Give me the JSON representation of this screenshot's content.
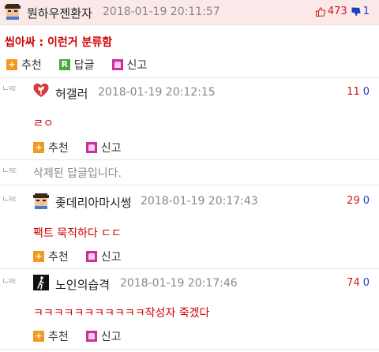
{
  "post": {
    "author": "뭔하우젠환자",
    "timestamp": "2018-01-19 20:11:57",
    "upvotes": "473",
    "downvotes": "1",
    "content": "씹아싸 : 이런거 분류함",
    "actions": {
      "recommend": "추천",
      "reply": "답글",
      "report": "신고"
    },
    "reply_badge": "R"
  },
  "re_label": "RE",
  "comments": [
    {
      "author": "허갤러",
      "timestamp": "2018-01-19 20:12:15",
      "up": "11",
      "down": "0",
      "text": "ㄹㅇ",
      "recommend": "추천",
      "report": "신고"
    },
    {
      "deleted_text": "삭제된 답글입니다."
    },
    {
      "author": "좆데리아마시썽",
      "timestamp": "2018-01-19 20:17:43",
      "up": "29",
      "down": "0",
      "text": "팩트 묵직하다 ㄷㄷ",
      "recommend": "추천",
      "report": "신고"
    },
    {
      "author": "노인의습격",
      "timestamp": "2018-01-19 20:17:46",
      "up": "74",
      "down": "0",
      "text": "ㅋㅋㅋㅋㅋㅋㅋㅋㅋㅋㅋ작성자 죽겠다",
      "recommend": "추천",
      "report": "신고"
    }
  ],
  "colors": {
    "header_bg": "#fbe9ea",
    "upvote": "#d01818",
    "downvote": "#1c3fc4",
    "comment_text": "#d00000"
  }
}
